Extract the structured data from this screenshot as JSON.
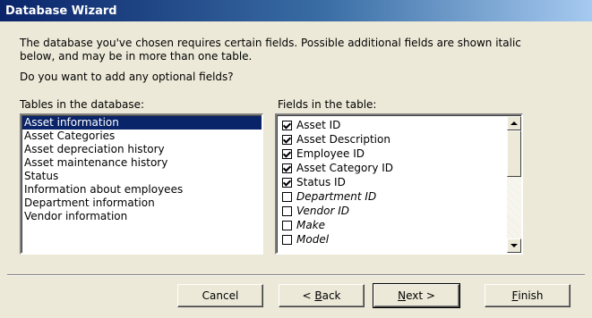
{
  "window": {
    "title": "Database Wizard"
  },
  "intro": {
    "line1": "The database you've chosen requires certain fields. Possible additional fields are shown italic",
    "line2": "below, and may be in more than one table.",
    "question": "Do you want to add any optional fields?"
  },
  "tables": {
    "label": "Tables in the database:",
    "items": [
      {
        "label": "Asset information",
        "selected": true
      },
      {
        "label": "Asset Categories",
        "selected": false
      },
      {
        "label": "Asset depreciation history",
        "selected": false
      },
      {
        "label": "Asset maintenance history",
        "selected": false
      },
      {
        "label": "Status",
        "selected": false
      },
      {
        "label": "Information about employees",
        "selected": false
      },
      {
        "label": "Department information",
        "selected": false
      },
      {
        "label": "Vendor information",
        "selected": false
      }
    ]
  },
  "fields": {
    "label": "Fields in the table:",
    "items": [
      {
        "label": "Asset ID",
        "checked": true,
        "optional": false
      },
      {
        "label": "Asset Description",
        "checked": true,
        "optional": false
      },
      {
        "label": "Employee ID",
        "checked": true,
        "optional": false
      },
      {
        "label": "Asset Category ID",
        "checked": true,
        "optional": false
      },
      {
        "label": "Status ID",
        "checked": true,
        "optional": false
      },
      {
        "label": "Department ID",
        "checked": false,
        "optional": true
      },
      {
        "label": "Vendor ID",
        "checked": false,
        "optional": true
      },
      {
        "label": "Make",
        "checked": false,
        "optional": true
      },
      {
        "label": "Model",
        "checked": false,
        "optional": true
      }
    ]
  },
  "buttons": {
    "cancel": {
      "pre": "Cancel",
      "key": "",
      "post": ""
    },
    "back": {
      "pre": "< ",
      "key": "B",
      "post": "ack"
    },
    "next": {
      "pre": "",
      "key": "N",
      "post": "ext >"
    },
    "finish": {
      "pre": "",
      "key": "F",
      "post": "inish"
    }
  },
  "colors": {
    "title_gradient_start": "#0a246a",
    "selection": "#0a246a",
    "dialog_bg": "#ece9d8"
  }
}
